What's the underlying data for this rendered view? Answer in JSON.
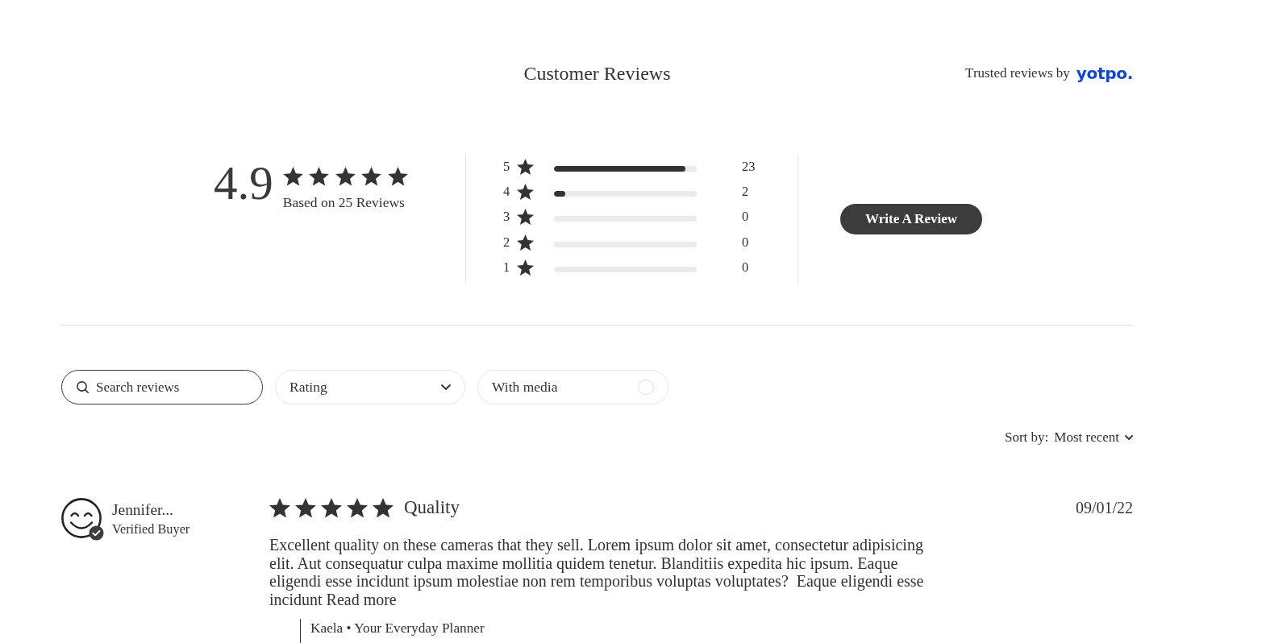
{
  "header": {
    "title": "Customer Reviews",
    "trusted_by": "Trusted reviews by",
    "brand": "yotpo."
  },
  "summary": {
    "average": "4.9",
    "stars": 5,
    "based_on": "Based on 25 Reviews",
    "distribution": [
      {
        "label": "5",
        "level": 0.92,
        "count": "23"
      },
      {
        "label": "4",
        "level": 0.08,
        "count": "2"
      },
      {
        "label": "3",
        "level": 0,
        "count": "0"
      },
      {
        "label": "2",
        "level": 0,
        "count": "0"
      },
      {
        "label": "1",
        "level": 0,
        "count": "0"
      }
    ],
    "write_button": "Write A Review"
  },
  "filters": {
    "search": {
      "placeholder": "Search reviews"
    },
    "rating": {
      "label": "Rating"
    },
    "media": {
      "label": "With media",
      "on": false
    }
  },
  "sort": {
    "label": "Sort by:",
    "value": "Most recent"
  },
  "reviews": [
    {
      "name": "Jennifer...",
      "verified": true,
      "badge": "Verified Buyer",
      "stars": 5,
      "title": "Quality",
      "date": "09/01/22",
      "body": "Excellent quality on these cameras that they sell. Lorem ipsum dolor sit amet, consectetur adipisicing elit. Aut consequatur culpa maxime mollitia quidem tenetur. Blanditiis expedita hic ipsum. Eaque eligendi esse incidunt ipsum molestiae non rem temporibus voluptas voluptates?  Eaque eligendi esse incidunt",
      "read_more": "Read more",
      "product": "Kaela • Your Everyday Planner"
    }
  ]
}
